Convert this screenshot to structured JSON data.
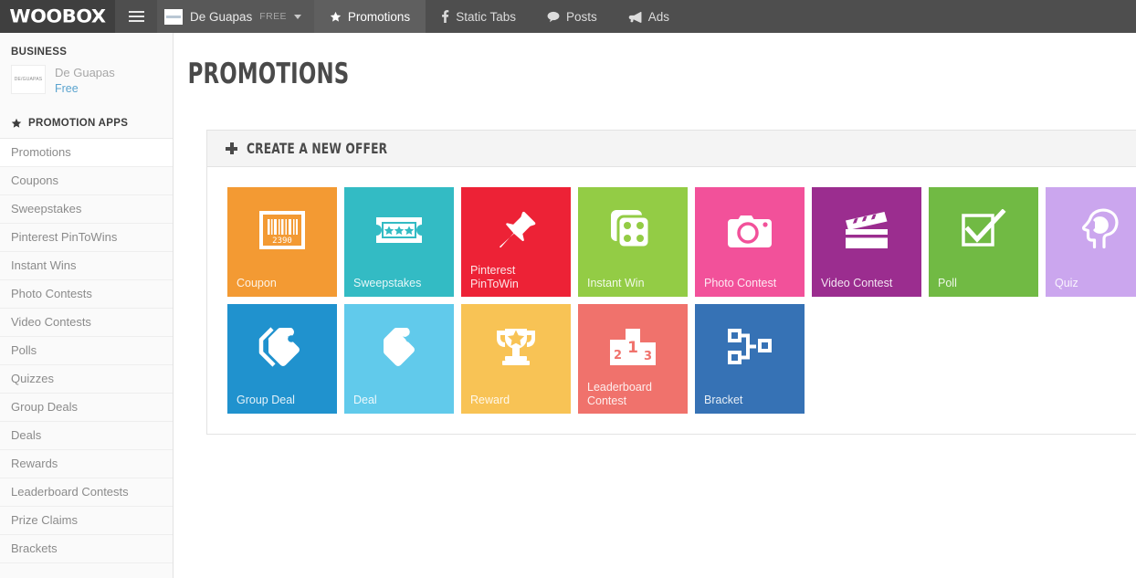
{
  "topbar": {
    "logo": "WOOBOX",
    "menu_icon": "hamburger-icon",
    "account": {
      "name": "De Guapas",
      "plan": "FREE",
      "caret": "chevron-down-icon"
    },
    "tabs": [
      {
        "label": "Promotions",
        "icon": "star-icon",
        "active": true
      },
      {
        "label": "Static Tabs",
        "icon": "facebook-icon",
        "active": false
      },
      {
        "label": "Posts",
        "icon": "comment-icon",
        "active": false
      },
      {
        "label": "Ads",
        "icon": "megaphone-icon",
        "active": false
      }
    ]
  },
  "sidebar": {
    "business_label": "BUSINESS",
    "business": {
      "name": "De Guapas",
      "plan": "Free",
      "thumb_text": "DE/GUAPAS"
    },
    "apps_header": "PROMOTION APPS",
    "apps_header_icon": "star-icon",
    "items": [
      {
        "label": "Promotions",
        "active": true
      },
      {
        "label": "Coupons",
        "active": false
      },
      {
        "label": "Sweepstakes",
        "active": false
      },
      {
        "label": "Pinterest PinToWins",
        "active": false
      },
      {
        "label": "Instant Wins",
        "active": false
      },
      {
        "label": "Photo Contests",
        "active": false
      },
      {
        "label": "Video Contests",
        "active": false
      },
      {
        "label": "Polls",
        "active": false
      },
      {
        "label": "Quizzes",
        "active": false
      },
      {
        "label": "Group Deals",
        "active": false
      },
      {
        "label": "Deals",
        "active": false
      },
      {
        "label": "Rewards",
        "active": false
      },
      {
        "label": "Leaderboard Contests",
        "active": false
      },
      {
        "label": "Prize Claims",
        "active": false
      },
      {
        "label": "Brackets",
        "active": false
      }
    ]
  },
  "main": {
    "page_title": "PROMOTIONS",
    "create_offer_label": "CREATE A NEW OFFER",
    "create_offer_icon": "plus-icon",
    "tiles_row1": [
      {
        "label": "Coupon",
        "icon": "barcode-icon",
        "color": "#F39A33"
      },
      {
        "label": "Sweepstakes",
        "icon": "ticket-icon",
        "color": "#33BBC4"
      },
      {
        "label": "Pinterest\nPinToWin",
        "icon": "pushpin-icon",
        "color": "#ED2236"
      },
      {
        "label": "Instant Win",
        "icon": "dice-icon",
        "color": "#93CC45"
      },
      {
        "label": "Photo Contest",
        "icon": "camera-icon",
        "color": "#F2519A"
      },
      {
        "label": "Video Contest",
        "icon": "clapperboard-icon",
        "color": "#9B2D8F"
      },
      {
        "label": "Poll",
        "icon": "checkbox-icon",
        "color": "#71BA44"
      },
      {
        "label": "Quiz",
        "icon": "brain-head-icon",
        "color": "#CBA6EE"
      }
    ],
    "tiles_row2": [
      {
        "label": "Group Deal",
        "icon": "double-tag-icon",
        "color": "#2092CE"
      },
      {
        "label": "Deal",
        "icon": "tag-icon",
        "color": "#61CAEB"
      },
      {
        "label": "Reward",
        "icon": "trophy-icon",
        "color": "#F8C355"
      },
      {
        "label": "Leaderboard\nContest",
        "icon": "podium-icon",
        "color": "#F0726C"
      },
      {
        "label": "Bracket",
        "icon": "bracket-icon",
        "color": "#3672B5"
      }
    ]
  }
}
